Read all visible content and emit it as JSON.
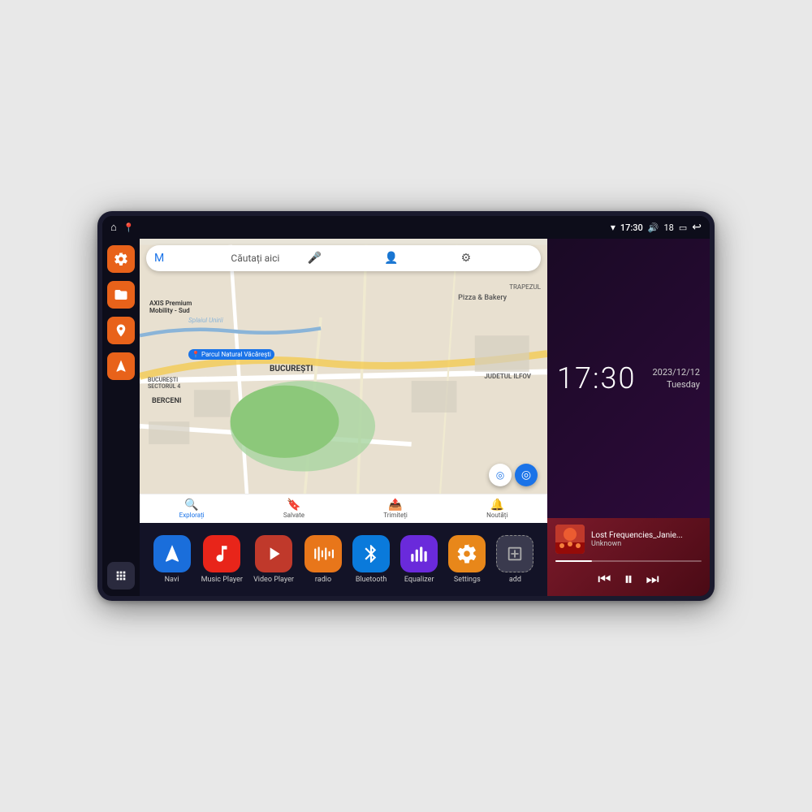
{
  "device": {
    "status_bar": {
      "time": "17:30",
      "signal": "▾",
      "volume_icon": "🔊",
      "battery_level": "18",
      "back_icon": "↩"
    },
    "clock": {
      "time": "17:30",
      "date": "2023/12/12",
      "day": "Tuesday"
    },
    "music": {
      "track_name": "Lost Frequencies_Janie...",
      "artist": "Unknown",
      "progress": 25
    },
    "map": {
      "search_placeholder": "Căutați aici",
      "labels": [
        "Parcul Natural Văcărești",
        "BUCUREȘTI",
        "BUCUREȘTI SECTORUL 4",
        "BERCENI",
        "JUDETUL ILFOV",
        "TRAPEZUL",
        "Pizza & Bakery",
        "AXIS Premium Mobility - Sud"
      ],
      "tabs": [
        "Explorați",
        "Salvate",
        "Trimiteți",
        "Noutăți"
      ]
    },
    "apps": [
      {
        "id": "navi",
        "label": "Navi",
        "color": "bg-blue",
        "icon": "⬆"
      },
      {
        "id": "music-player",
        "label": "Music Player",
        "color": "bg-red",
        "icon": "♪"
      },
      {
        "id": "video-player",
        "label": "Video Player",
        "color": "bg-red2",
        "icon": "▶"
      },
      {
        "id": "radio",
        "label": "radio",
        "color": "bg-orange",
        "icon": "📶"
      },
      {
        "id": "bluetooth",
        "label": "Bluetooth",
        "color": "bg-blue2",
        "icon": "✦"
      },
      {
        "id": "equalizer",
        "label": "Equalizer",
        "color": "bg-purple",
        "icon": "▐"
      },
      {
        "id": "settings",
        "label": "Settings",
        "color": "bg-orange2",
        "icon": "⚙"
      },
      {
        "id": "add",
        "label": "add",
        "color": "bg-gray",
        "icon": "+"
      }
    ],
    "sidebar": [
      {
        "id": "settings",
        "icon": "⚙",
        "color": "orange"
      },
      {
        "id": "files",
        "icon": "▬",
        "color": "orange"
      },
      {
        "id": "map",
        "icon": "📍",
        "color": "orange"
      },
      {
        "id": "nav",
        "icon": "▲",
        "color": "orange"
      }
    ]
  }
}
